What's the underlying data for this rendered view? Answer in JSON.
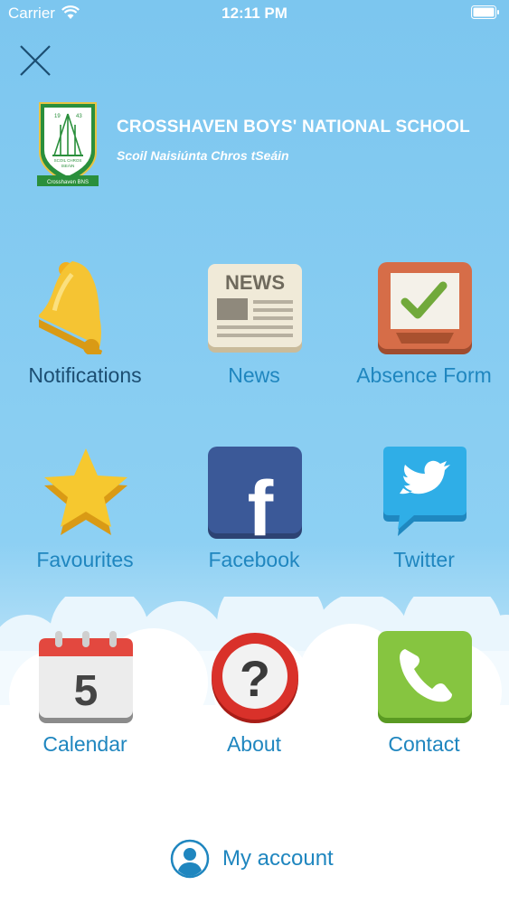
{
  "status_bar": {
    "carrier": "Carrier",
    "time": "12:11 PM"
  },
  "header": {
    "title": "CROSSHAVEN BOYS' NATIONAL SCHOOL",
    "subtitle": "Scoil Naisiúnta Chros tSeáin",
    "crest": {
      "year_left": "19",
      "year_right": "43",
      "motto_line1": "SCOIL CHROS",
      "motto_line2": "tSEÁIN",
      "banner": "Crosshaven BNS"
    }
  },
  "menu": {
    "notifications": {
      "label": "Notifications",
      "icon": "bell-icon"
    },
    "news": {
      "label": "News",
      "icon": "newspaper-icon",
      "icon_text": "NEWS"
    },
    "absence_form": {
      "label": "Absence Form",
      "icon": "checkbox-tray-icon"
    },
    "favourites": {
      "label": "Favourites",
      "icon": "star-icon"
    },
    "facebook": {
      "label": "Facebook",
      "icon": "facebook-icon",
      "icon_text": "f"
    },
    "twitter": {
      "label": "Twitter",
      "icon": "twitter-icon"
    },
    "calendar": {
      "label": "Calendar",
      "icon": "calendar-icon",
      "icon_text": "5"
    },
    "about": {
      "label": "About",
      "icon": "question-icon",
      "icon_text": "?"
    },
    "contact": {
      "label": "Contact",
      "icon": "phone-icon"
    }
  },
  "account": {
    "label": "My account",
    "icon": "user-icon"
  },
  "colors": {
    "background": "#7cc6ef",
    "label_blue": "#1f86bf",
    "label_dark": "#1c4e72"
  }
}
